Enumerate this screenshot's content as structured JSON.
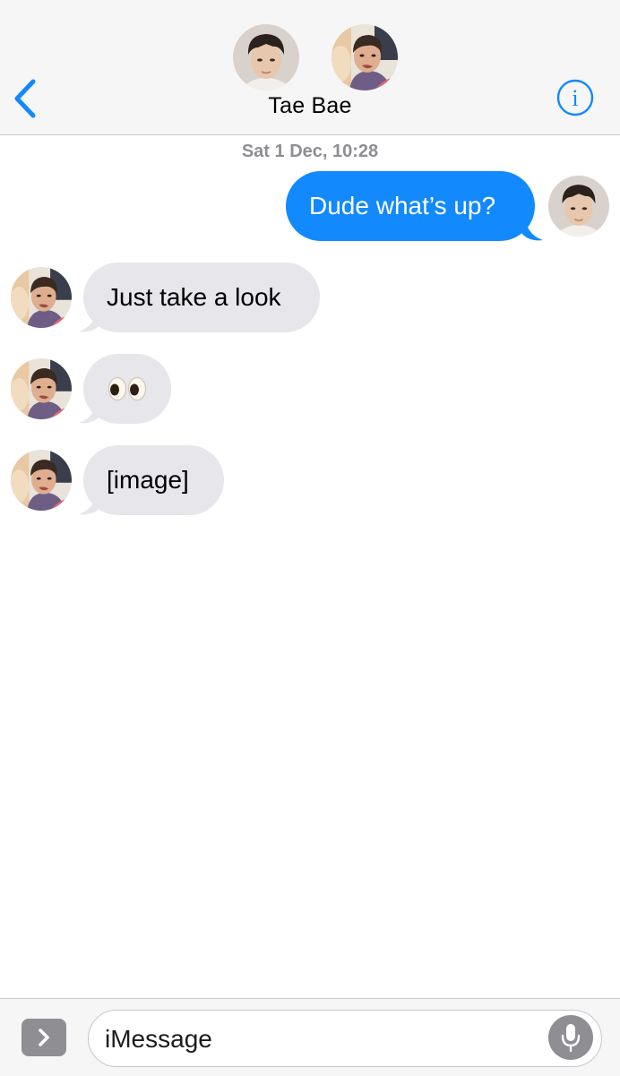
{
  "header": {
    "contact_name": "Tae Bae",
    "back_icon": "chevron-left-icon",
    "info_icon": "info-circle-icon",
    "accent_color": "#1289fd"
  },
  "conversation": {
    "timestamp": "Sat 1 Dec, 10:28",
    "messages": [
      {
        "direction": "outgoing",
        "text": "Dude what’s up?"
      },
      {
        "direction": "incoming",
        "text": "Just take a look"
      },
      {
        "direction": "incoming",
        "text": "👀"
      },
      {
        "direction": "incoming",
        "text": "[image]"
      }
    ],
    "outgoing_bubble_color": "#1289fd",
    "incoming_bubble_color": "#e6e6eb"
  },
  "input_bar": {
    "placeholder": "iMessage",
    "apps_icon": "chevron-right-icon",
    "mic_icon": "microphone-icon"
  }
}
